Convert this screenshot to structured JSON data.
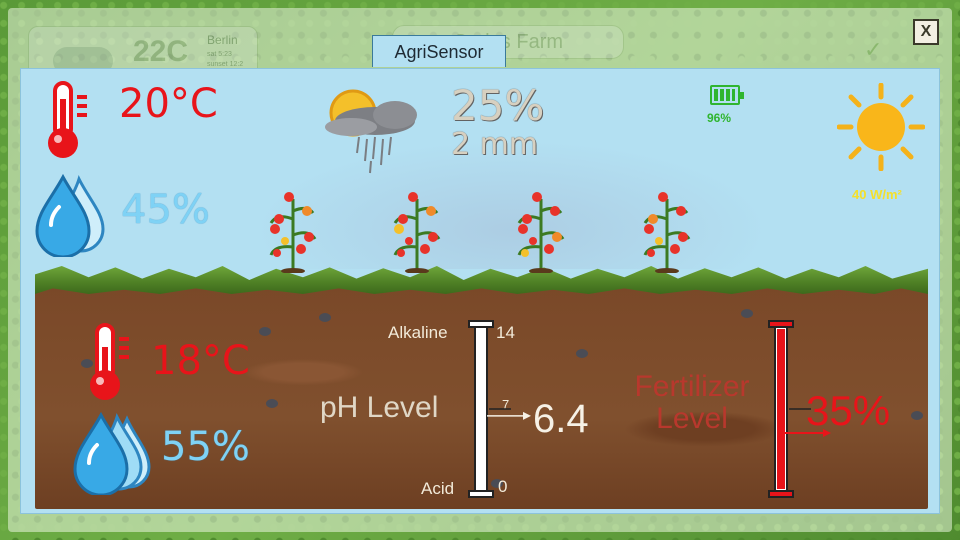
{
  "background_app": {
    "weather_temp": "22C",
    "weather_city": "Berlin",
    "weather_sunrise": "sat 5:23",
    "weather_sunset": "sunset 12:2",
    "farm_name": "Cedes Farm"
  },
  "window": {
    "title": "AgriSensor",
    "close_label": "X"
  },
  "air": {
    "temperature": "20°C",
    "humidity": "45%"
  },
  "rain": {
    "probability": "25%",
    "amount": "2 mm"
  },
  "battery": {
    "level": "96%",
    "level_fraction": 0.96,
    "color": "#2fb52f"
  },
  "solar": {
    "radiation": "40 W/m²"
  },
  "soil": {
    "temperature": "18°C",
    "humidity": "55%"
  },
  "ph": {
    "label": "pH Level",
    "top_label": "Alkaline",
    "top_value": "14",
    "mid_value": "7",
    "bottom_label": "Acid",
    "bottom_value": "0",
    "value": "6.4",
    "value_number": 6.4
  },
  "fertilizer": {
    "label": "Fertilizer Level",
    "value": "35%",
    "value_fraction": 0.35
  },
  "icons": {
    "air_temp": "thermometer-icon",
    "air_humidity": "water-drops-icon",
    "weather": "sun-cloud-rain-icon",
    "battery": "battery-icon",
    "sun": "sun-icon",
    "plant": "tomato-plant-icon",
    "soil_temp": "thermometer-icon",
    "soil_humidity": "water-drops-icon"
  },
  "colors": {
    "temperature": "#e8141a",
    "humidity": "#7fd2f5",
    "sky": "#b3e0f2",
    "sun": "#f4c02a"
  }
}
